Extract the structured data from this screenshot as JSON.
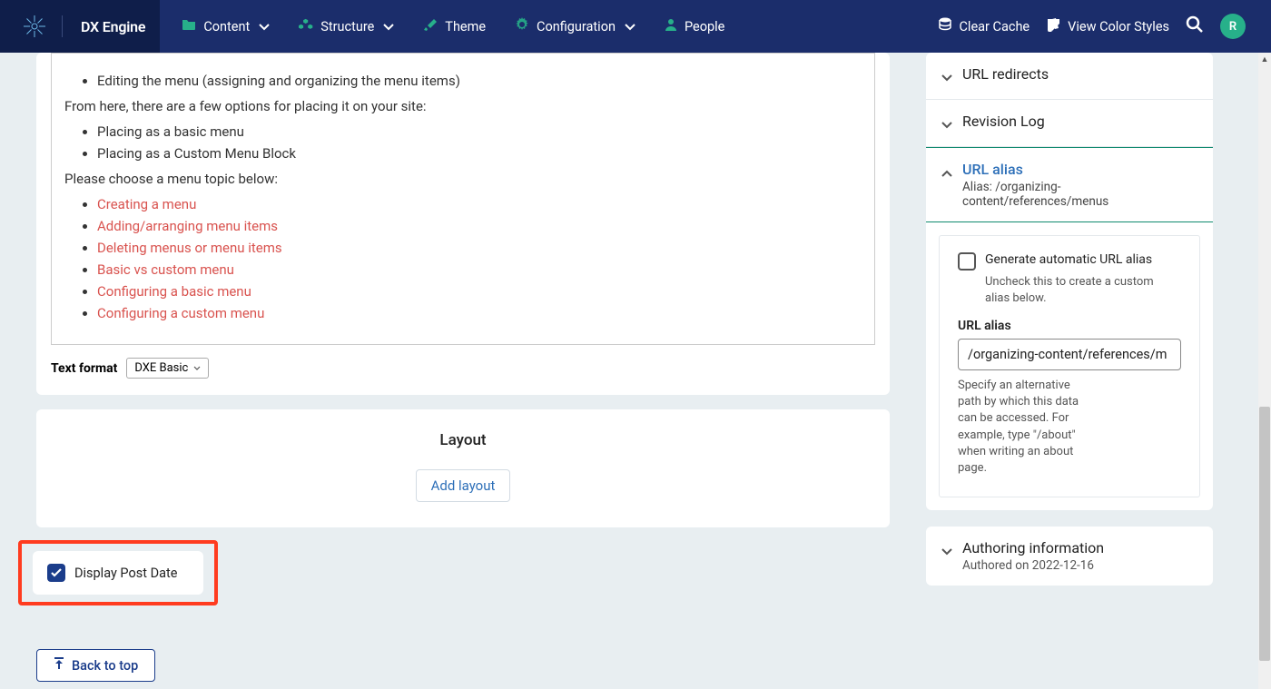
{
  "brand": "DX Engine",
  "nav": {
    "content": "Content",
    "structure": "Structure",
    "theme": "Theme",
    "configuration": "Configuration",
    "people": "People",
    "clear_cache": "Clear Cache",
    "view_colors": "View Color Styles"
  },
  "avatar": "R",
  "editor": {
    "line_editing": "Editing the menu (assigning and organizing the menu items)",
    "line_from_here": "From here, there are a few options for placing it on your site:",
    "placing_basic": "Placing as a basic menu",
    "placing_custom": "Placing as a Custom Menu Block",
    "choose": "Please choose a menu topic below:",
    "links": {
      "l1": "Creating a menu",
      "l2": "Adding/arranging menu items",
      "l3": "Deleting menus or menu items",
      "l4": "Basic vs custom menu",
      "l5": "Configuring a basic menu",
      "l6": "Configuring a custom menu"
    }
  },
  "textformat": {
    "label": "Text format",
    "value": "DXE Basic"
  },
  "layout": {
    "title": "Layout",
    "add": "Add layout"
  },
  "postdate": {
    "label": "Display Post Date"
  },
  "backtop": "Back to top",
  "side": {
    "url_redirects": "URL redirects",
    "revision_log": "Revision Log",
    "url_alias_title": "URL alias",
    "url_alias_sub": "Alias: /organizing-content/references/menus",
    "gen_auto": "Generate automatic URL alias",
    "gen_help": "Uncheck this to create a custom alias below.",
    "alias_field": "URL alias",
    "alias_value": "/organizing-content/references/m",
    "alias_help": "Specify an alternative path by which this data can be accessed. For example, type \"/about\" when writing an about page.",
    "auth_title": "Authoring information",
    "auth_sub": "Authored on 2022-12-16"
  }
}
